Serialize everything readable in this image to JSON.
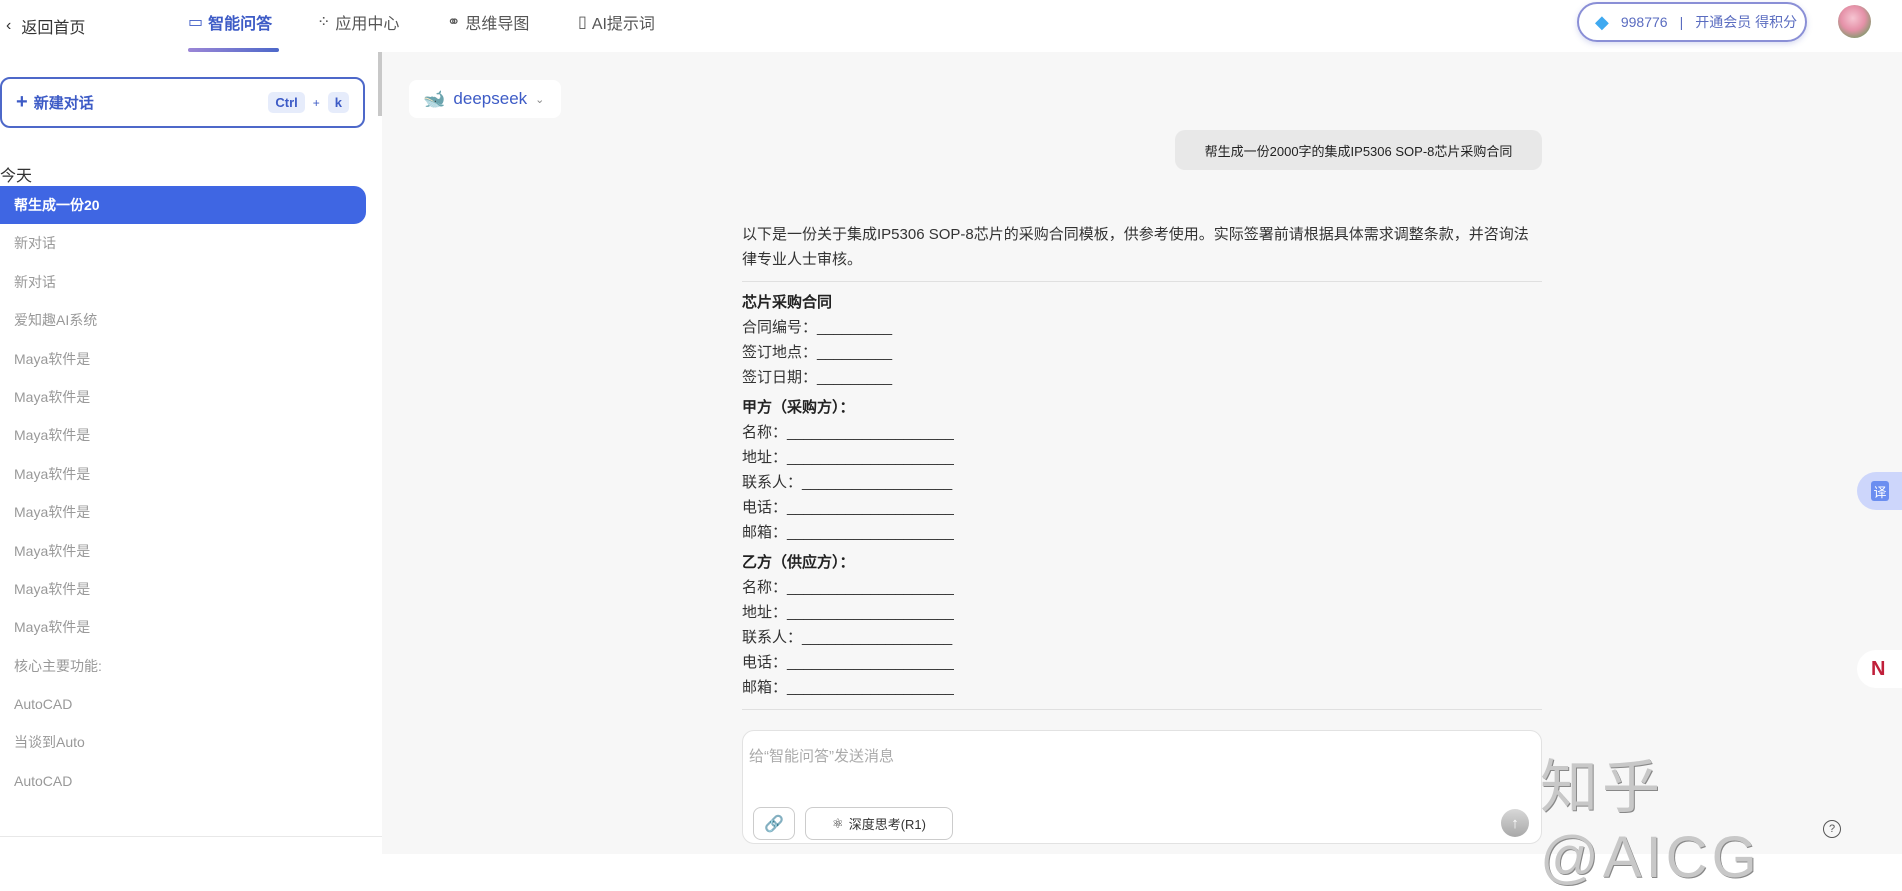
{
  "header": {
    "back_label": "返回首页",
    "tabs": [
      {
        "label": "智能问答",
        "active": true
      },
      {
        "label": "应用中心"
      },
      {
        "label": "思维导图"
      },
      {
        "label": "AI提示词"
      }
    ],
    "points": "998776",
    "member_label": "开通会员 得积分"
  },
  "sidebar": {
    "new_chat_label": "新建对话",
    "shortcut": {
      "key1": "Ctrl",
      "plus": "+",
      "key2": "k"
    },
    "group_label": "今天",
    "items": [
      "帮生成一份20",
      "新对话",
      "新对话",
      "爱知趣AI系统",
      "Maya软件是",
      "Maya软件是",
      "Maya软件是",
      "Maya软件是",
      "Maya软件是",
      "Maya软件是",
      "Maya软件是",
      "Maya软件是",
      "核心主要功能:",
      "AutoCAD",
      "当谈到Auto",
      "AutoCAD"
    ]
  },
  "chat": {
    "model": "deepseek",
    "user_message": "帮生成一份2000字的集成IP5306 SOP-8芯片采购合同",
    "intro": "以下是一份关于集成IP5306 SOP-8芯片的采购合同模板，供参考使用。实际签署前请根据具体需求调整条款，并咨询法律专业人士审核。",
    "contract_title": "芯片采购合同",
    "contract_fields": [
      "合同编号：_________",
      "签订地点：_________",
      "签订日期：_________"
    ],
    "party_a_title": "甲方（采购方）：",
    "party_a_fields": [
      "名称：____________________",
      "地址：____________________",
      "联系人：__________________",
      "电话：____________________",
      "邮箱：____________________"
    ],
    "party_b_title": "乙方（供应方）：",
    "party_b_fields": [
      "名称：____________________",
      "地址：____________________",
      "联系人：__________________",
      "电话：____________________",
      "邮箱：____________________"
    ]
  },
  "composer": {
    "placeholder": "给“智能问答”发送消息",
    "deep_think_label": "深度思考(R1)"
  },
  "floating": {
    "translate_label": "译",
    "help_label": "?"
  },
  "watermark": "知乎 @AICG"
}
